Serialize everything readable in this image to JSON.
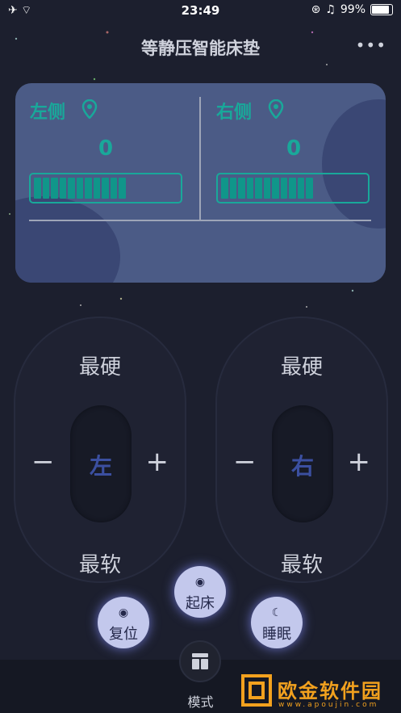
{
  "status": {
    "time": "23:49",
    "battery": "99%"
  },
  "header": {
    "title": "等静压智能床垫",
    "more": "•••"
  },
  "pressure": {
    "left": {
      "label": "左侧",
      "value": "0",
      "level": 0.6
    },
    "right": {
      "label": "右侧",
      "value": "0",
      "level": 0.6
    }
  },
  "controls": {
    "left": {
      "top": "最硬",
      "bottom": "最软",
      "side": "左",
      "minus": "−",
      "plus": "+"
    },
    "right": {
      "top": "最硬",
      "bottom": "最软",
      "side": "右",
      "minus": "−",
      "plus": "+"
    }
  },
  "modes": {
    "reset": "复位",
    "wake": "起床",
    "sleep": "睡眠"
  },
  "tabbar": {
    "mode": "模式"
  },
  "watermark": {
    "text": "欧金软件园",
    "url": "www.apoujin.com"
  },
  "colors": {
    "accent": "#19a89a",
    "card": "#4b5b86",
    "button": "#c3c8ec"
  }
}
